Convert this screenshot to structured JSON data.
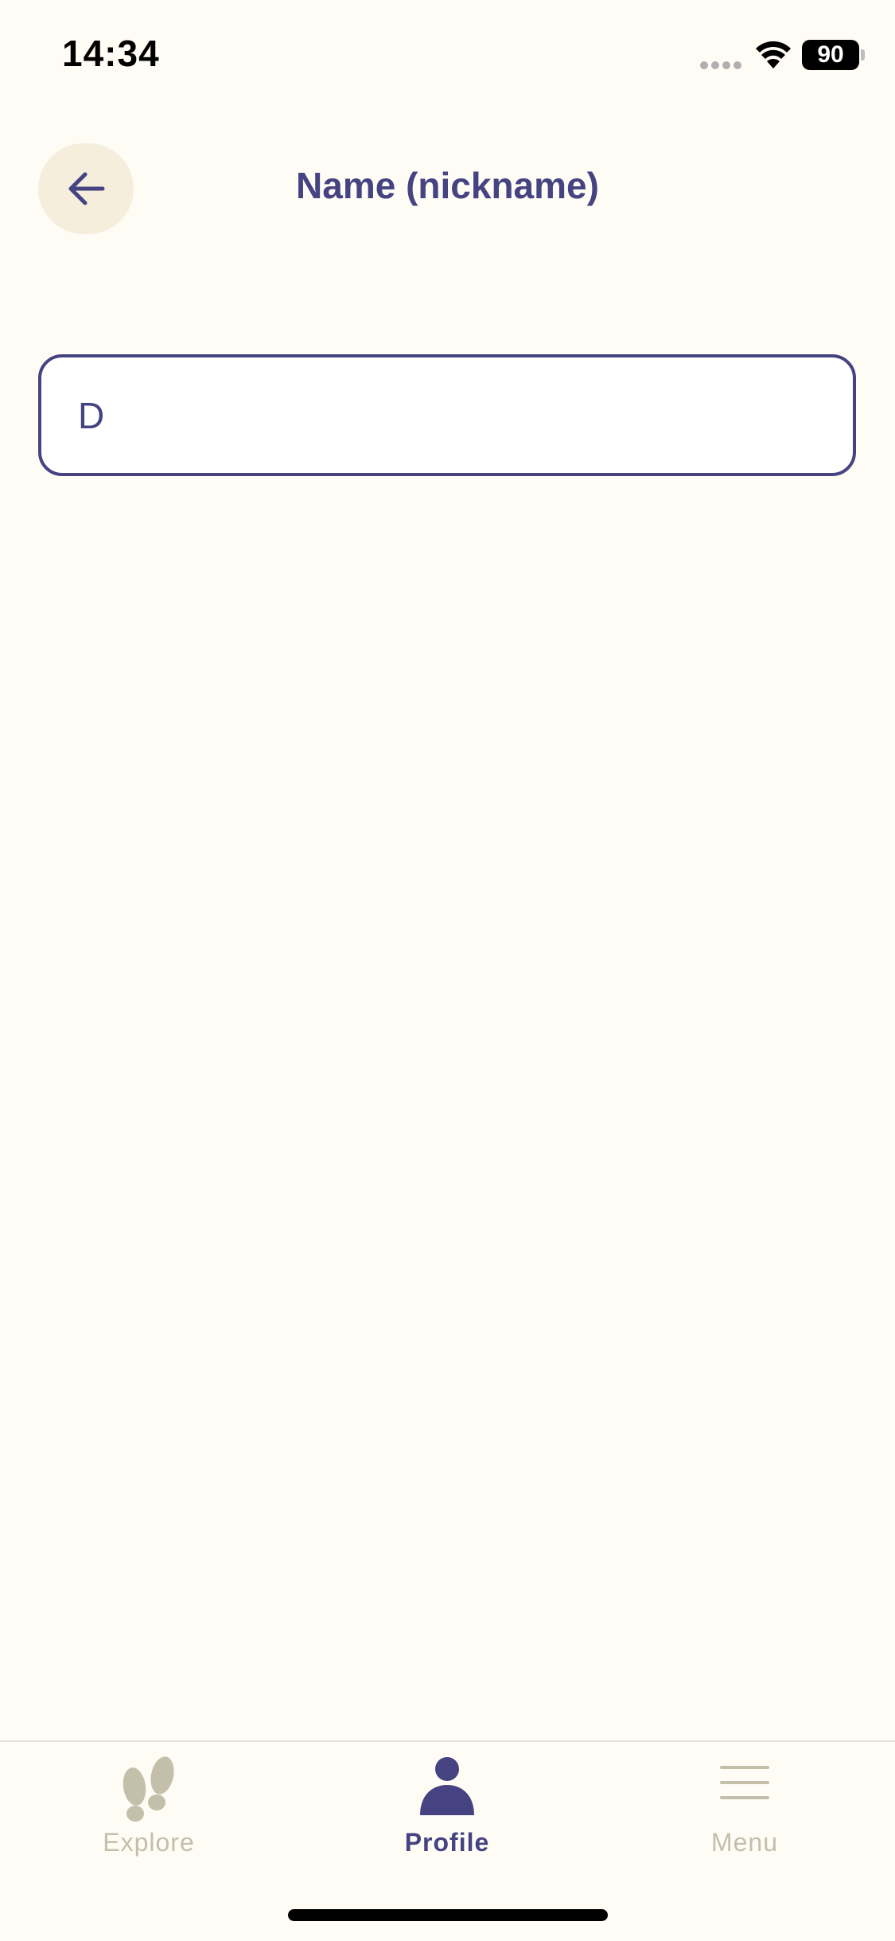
{
  "status_bar": {
    "time": "14:34",
    "battery_level": "90",
    "signal_icon": "signal-dots-icon",
    "wifi_icon": "wifi-icon"
  },
  "header": {
    "back_icon": "arrow-left-icon",
    "title": "Name (nickname)"
  },
  "form": {
    "name_value": "D",
    "placeholder": ""
  },
  "tab_bar": {
    "active": "Profile",
    "tabs": [
      {
        "label": "Explore",
        "icon": "footprints-icon"
      },
      {
        "label": "Profile",
        "icon": "person-icon"
      },
      {
        "label": "Menu",
        "icon": "hamburger-menu-icon"
      }
    ]
  },
  "colors": {
    "background": "#FEFCF5",
    "accent": "#454381",
    "inactive": "#C4BFAA",
    "back_button_bg": "#F5EEDC"
  }
}
